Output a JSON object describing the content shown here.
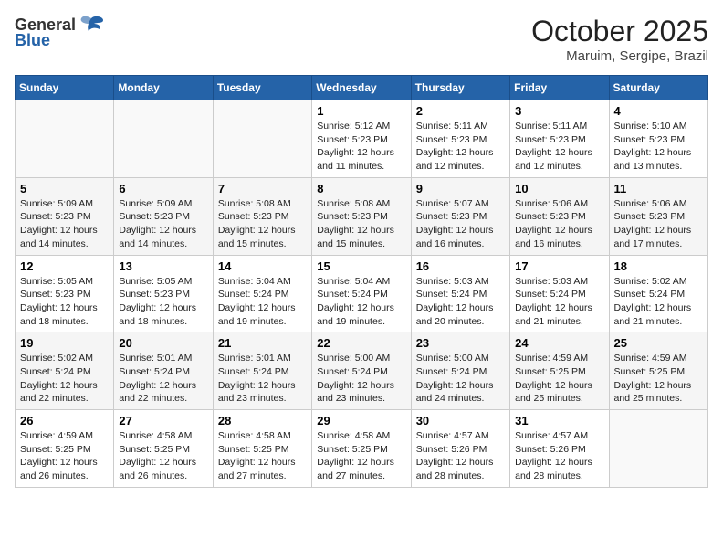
{
  "header": {
    "logo_general": "General",
    "logo_blue": "Blue",
    "month": "October 2025",
    "location": "Maruim, Sergipe, Brazil"
  },
  "days_of_week": [
    "Sunday",
    "Monday",
    "Tuesday",
    "Wednesday",
    "Thursday",
    "Friday",
    "Saturday"
  ],
  "weeks": [
    [
      {
        "day": "",
        "info": ""
      },
      {
        "day": "",
        "info": ""
      },
      {
        "day": "",
        "info": ""
      },
      {
        "day": "1",
        "info": "Sunrise: 5:12 AM\nSunset: 5:23 PM\nDaylight: 12 hours\nand 11 minutes."
      },
      {
        "day": "2",
        "info": "Sunrise: 5:11 AM\nSunset: 5:23 PM\nDaylight: 12 hours\nand 12 minutes."
      },
      {
        "day": "3",
        "info": "Sunrise: 5:11 AM\nSunset: 5:23 PM\nDaylight: 12 hours\nand 12 minutes."
      },
      {
        "day": "4",
        "info": "Sunrise: 5:10 AM\nSunset: 5:23 PM\nDaylight: 12 hours\nand 13 minutes."
      }
    ],
    [
      {
        "day": "5",
        "info": "Sunrise: 5:09 AM\nSunset: 5:23 PM\nDaylight: 12 hours\nand 14 minutes."
      },
      {
        "day": "6",
        "info": "Sunrise: 5:09 AM\nSunset: 5:23 PM\nDaylight: 12 hours\nand 14 minutes."
      },
      {
        "day": "7",
        "info": "Sunrise: 5:08 AM\nSunset: 5:23 PM\nDaylight: 12 hours\nand 15 minutes."
      },
      {
        "day": "8",
        "info": "Sunrise: 5:08 AM\nSunset: 5:23 PM\nDaylight: 12 hours\nand 15 minutes."
      },
      {
        "day": "9",
        "info": "Sunrise: 5:07 AM\nSunset: 5:23 PM\nDaylight: 12 hours\nand 16 minutes."
      },
      {
        "day": "10",
        "info": "Sunrise: 5:06 AM\nSunset: 5:23 PM\nDaylight: 12 hours\nand 16 minutes."
      },
      {
        "day": "11",
        "info": "Sunrise: 5:06 AM\nSunset: 5:23 PM\nDaylight: 12 hours\nand 17 minutes."
      }
    ],
    [
      {
        "day": "12",
        "info": "Sunrise: 5:05 AM\nSunset: 5:23 PM\nDaylight: 12 hours\nand 18 minutes."
      },
      {
        "day": "13",
        "info": "Sunrise: 5:05 AM\nSunset: 5:23 PM\nDaylight: 12 hours\nand 18 minutes."
      },
      {
        "day": "14",
        "info": "Sunrise: 5:04 AM\nSunset: 5:24 PM\nDaylight: 12 hours\nand 19 minutes."
      },
      {
        "day": "15",
        "info": "Sunrise: 5:04 AM\nSunset: 5:24 PM\nDaylight: 12 hours\nand 19 minutes."
      },
      {
        "day": "16",
        "info": "Sunrise: 5:03 AM\nSunset: 5:24 PM\nDaylight: 12 hours\nand 20 minutes."
      },
      {
        "day": "17",
        "info": "Sunrise: 5:03 AM\nSunset: 5:24 PM\nDaylight: 12 hours\nand 21 minutes."
      },
      {
        "day": "18",
        "info": "Sunrise: 5:02 AM\nSunset: 5:24 PM\nDaylight: 12 hours\nand 21 minutes."
      }
    ],
    [
      {
        "day": "19",
        "info": "Sunrise: 5:02 AM\nSunset: 5:24 PM\nDaylight: 12 hours\nand 22 minutes."
      },
      {
        "day": "20",
        "info": "Sunrise: 5:01 AM\nSunset: 5:24 PM\nDaylight: 12 hours\nand 22 minutes."
      },
      {
        "day": "21",
        "info": "Sunrise: 5:01 AM\nSunset: 5:24 PM\nDaylight: 12 hours\nand 23 minutes."
      },
      {
        "day": "22",
        "info": "Sunrise: 5:00 AM\nSunset: 5:24 PM\nDaylight: 12 hours\nand 23 minutes."
      },
      {
        "day": "23",
        "info": "Sunrise: 5:00 AM\nSunset: 5:24 PM\nDaylight: 12 hours\nand 24 minutes."
      },
      {
        "day": "24",
        "info": "Sunrise: 4:59 AM\nSunset: 5:25 PM\nDaylight: 12 hours\nand 25 minutes."
      },
      {
        "day": "25",
        "info": "Sunrise: 4:59 AM\nSunset: 5:25 PM\nDaylight: 12 hours\nand 25 minutes."
      }
    ],
    [
      {
        "day": "26",
        "info": "Sunrise: 4:59 AM\nSunset: 5:25 PM\nDaylight: 12 hours\nand 26 minutes."
      },
      {
        "day": "27",
        "info": "Sunrise: 4:58 AM\nSunset: 5:25 PM\nDaylight: 12 hours\nand 26 minutes."
      },
      {
        "day": "28",
        "info": "Sunrise: 4:58 AM\nSunset: 5:25 PM\nDaylight: 12 hours\nand 27 minutes."
      },
      {
        "day": "29",
        "info": "Sunrise: 4:58 AM\nSunset: 5:25 PM\nDaylight: 12 hours\nand 27 minutes."
      },
      {
        "day": "30",
        "info": "Sunrise: 4:57 AM\nSunset: 5:26 PM\nDaylight: 12 hours\nand 28 minutes."
      },
      {
        "day": "31",
        "info": "Sunrise: 4:57 AM\nSunset: 5:26 PM\nDaylight: 12 hours\nand 28 minutes."
      },
      {
        "day": "",
        "info": ""
      }
    ]
  ]
}
